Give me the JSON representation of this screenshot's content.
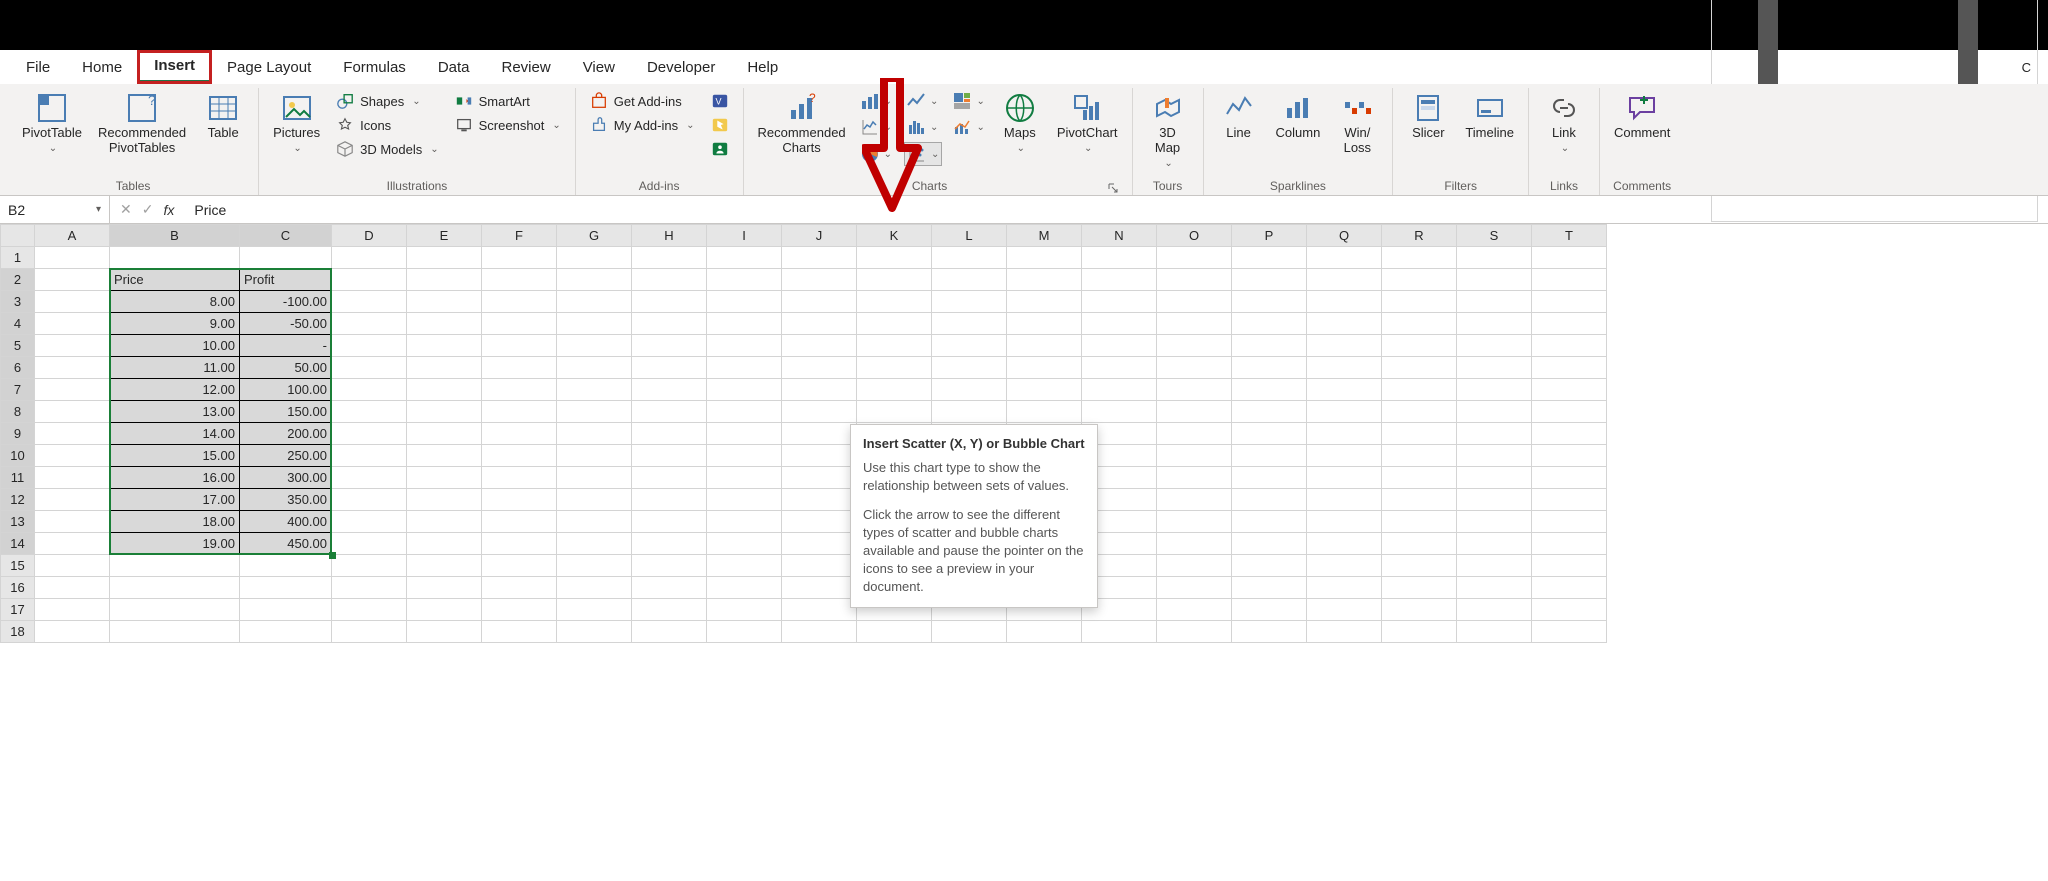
{
  "tabs": {
    "file": "File",
    "home": "Home",
    "insert": "Insert",
    "page_layout": "Page Layout",
    "formulas": "Formulas",
    "data": "Data",
    "review": "Review",
    "view": "View",
    "developer": "Developer",
    "help": "Help",
    "comments_corner": "C"
  },
  "ribbon": {
    "tables": {
      "pivottable": "PivotTable",
      "rec_pivot": "Recommended\nPivotTables",
      "table": "Table",
      "label": "Tables"
    },
    "illus": {
      "pictures": "Pictures",
      "shapes": "Shapes",
      "icons": "Icons",
      "models": "3D Models",
      "smartart": "SmartArt",
      "screenshot": "Screenshot",
      "label": "Illustrations"
    },
    "addins": {
      "get": "Get Add-ins",
      "my": "My Add-ins",
      "label": "Add-ins"
    },
    "charts": {
      "rec": "Recommended\nCharts",
      "maps": "Maps",
      "pivotchart": "PivotChart",
      "label": "Charts"
    },
    "tours": {
      "map3d": "3D\nMap",
      "label": "Tours"
    },
    "spark": {
      "line": "Line",
      "column": "Column",
      "winloss": "Win/\nLoss",
      "label": "Sparklines"
    },
    "filters": {
      "slicer": "Slicer",
      "timeline": "Timeline",
      "label": "Filters"
    },
    "links": {
      "link": "Link",
      "label": "Links"
    },
    "comments": {
      "comment": "Comment",
      "label": "Comments"
    }
  },
  "fx": {
    "name_box": "B2",
    "formula": "Price"
  },
  "grid": {
    "cols": [
      "A",
      "B",
      "C",
      "D",
      "E",
      "F",
      "G",
      "H",
      "I",
      "J",
      "K",
      "L",
      "M",
      "N",
      "O",
      "P",
      "Q",
      "R",
      "S",
      "T"
    ],
    "rows": 18,
    "headers": {
      "price": "Price",
      "profit": "Profit"
    },
    "data": [
      {
        "price": "8.00",
        "profit": "-100.00"
      },
      {
        "price": "9.00",
        "profit": "-50.00"
      },
      {
        "price": "10.00",
        "profit": "-"
      },
      {
        "price": "11.00",
        "profit": "50.00"
      },
      {
        "price": "12.00",
        "profit": "100.00"
      },
      {
        "price": "13.00",
        "profit": "150.00"
      },
      {
        "price": "14.00",
        "profit": "200.00"
      },
      {
        "price": "15.00",
        "profit": "250.00"
      },
      {
        "price": "16.00",
        "profit": "300.00"
      },
      {
        "price": "17.00",
        "profit": "350.00"
      },
      {
        "price": "18.00",
        "profit": "400.00"
      },
      {
        "price": "19.00",
        "profit": "450.00"
      }
    ]
  },
  "tooltip": {
    "title": "Insert Scatter (X, Y) or Bubble Chart",
    "p1": "Use this chart type to show the relationship between sets of values.",
    "p2": "Click the arrow to see the different types of scatter and bubble charts available and pause the pointer on the icons to see a preview in your document."
  }
}
